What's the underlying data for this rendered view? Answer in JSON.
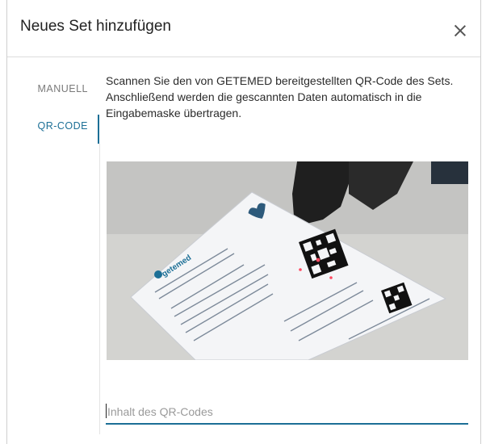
{
  "dialog": {
    "title": "Neues Set hinzufügen",
    "close_icon": "close-icon"
  },
  "tabs": [
    {
      "label": "MANUELL",
      "active": false
    },
    {
      "label": "QR-CODE",
      "active": true
    }
  ],
  "description": "Scannen Sie den von GETEMED bereitgestellten QR-Code des Sets. Anschließend werden die gescannten Daten automatisch in die Eingabemaske übertragen.",
  "photo": {
    "logo_text": "getemed"
  },
  "qr_input": {
    "placeholder": "Inhalt des QR-Codes",
    "value": ""
  },
  "colors": {
    "accent": "#1c6f96",
    "divider": "#dcdcdc"
  }
}
